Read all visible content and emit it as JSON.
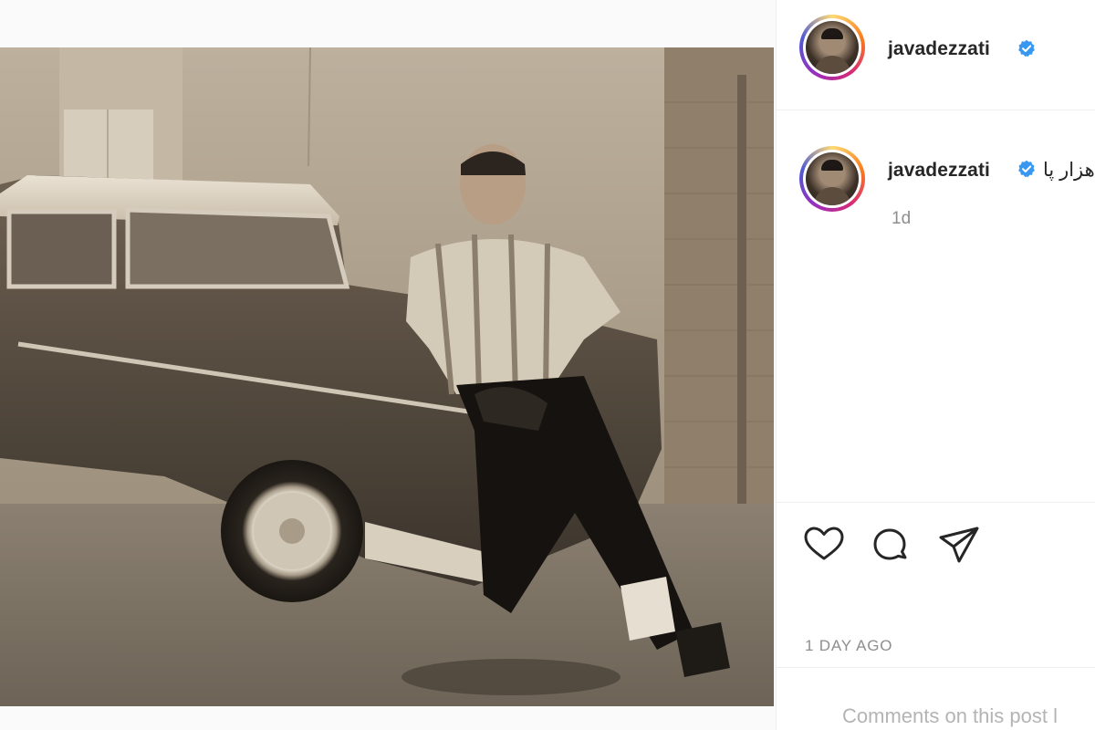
{
  "post": {
    "author": {
      "username": "javadezzati",
      "verified": true,
      "avatar_icon": "profile-photo"
    },
    "caption": {
      "username": "javadezzati",
      "text": "هزار پا",
      "time": "1d"
    },
    "actions": {
      "like_icon": "heart-icon",
      "comment_icon": "comment-icon",
      "share_icon": "send-icon"
    },
    "posted_ago": "1 DAY AGO",
    "comments_note": "Comments on this post l"
  },
  "colors": {
    "verified_badge": "#3897f0",
    "text_primary": "#262626",
    "text_secondary": "#8e8e8e",
    "divider": "#efefef"
  }
}
